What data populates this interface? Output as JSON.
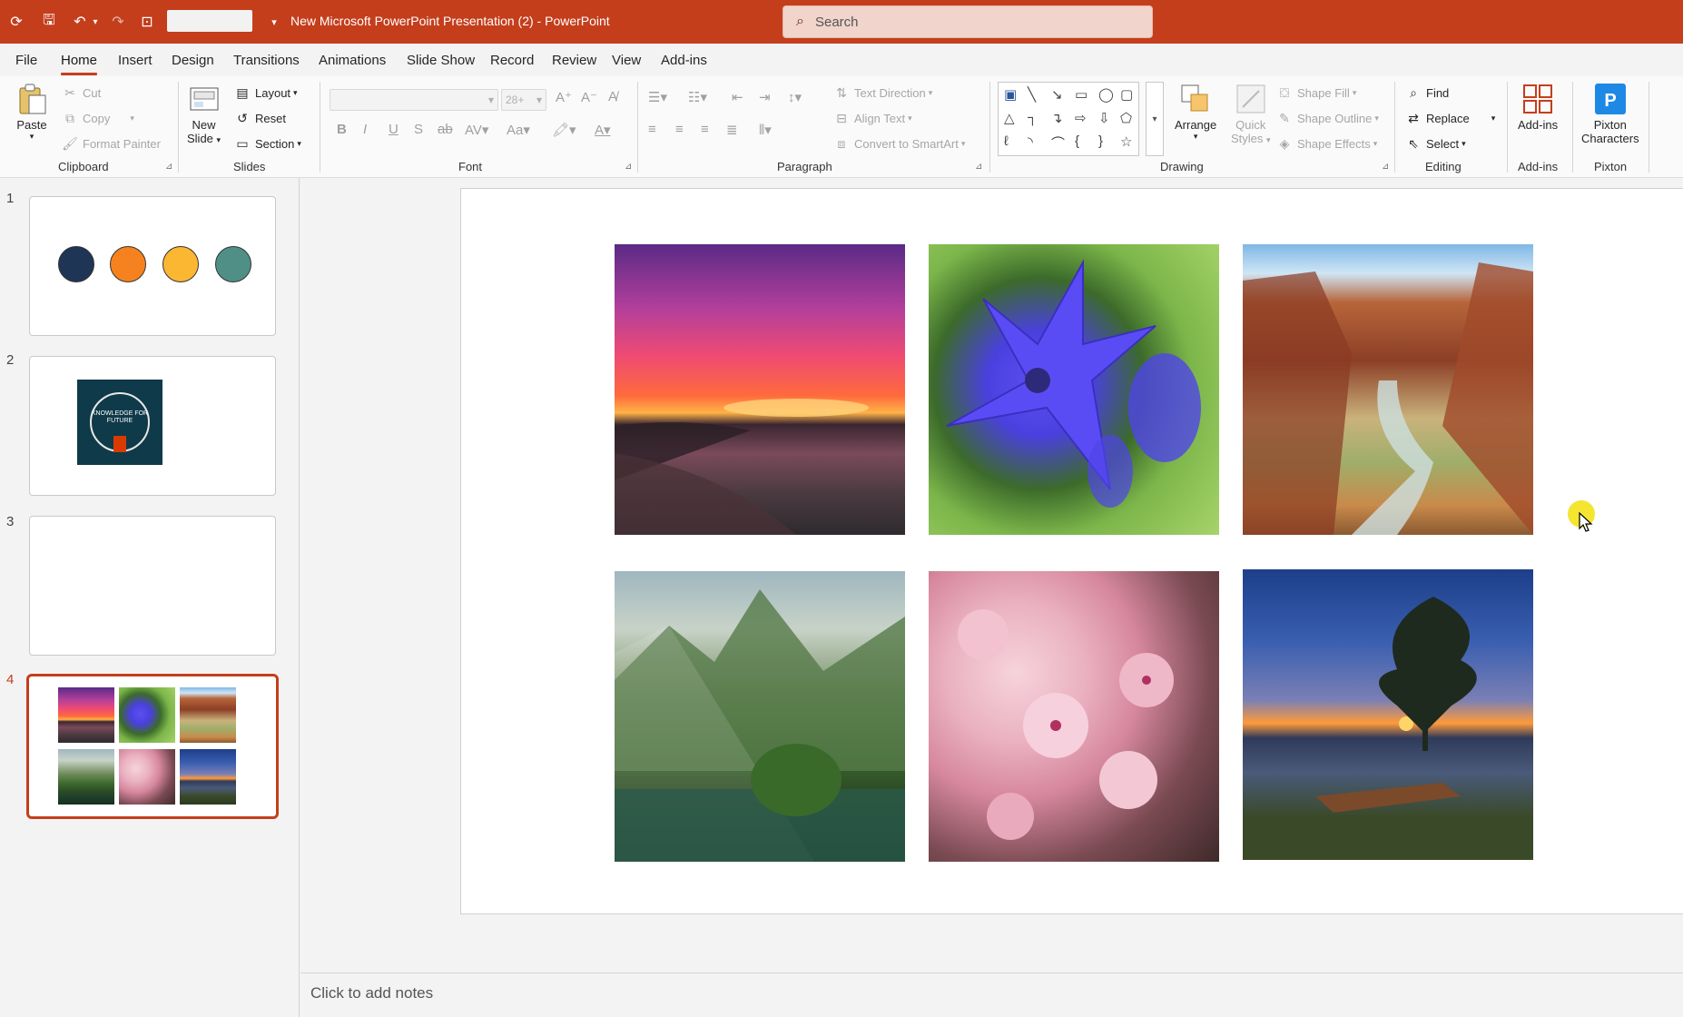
{
  "window": {
    "doc_title": "New Microsoft PowerPoint Presentation (2)  -  PowerPoint",
    "search_placeholder": "Search"
  },
  "menu": {
    "tabs": [
      "File",
      "Home",
      "Insert",
      "Design",
      "Transitions",
      "Animations",
      "Slide Show",
      "Record",
      "Review",
      "View",
      "Add-ins"
    ],
    "active": "Home"
  },
  "ribbon": {
    "clipboard": {
      "label": "Clipboard",
      "paste": "Paste",
      "cut": "Cut",
      "copy": "Copy",
      "format_painter": "Format Painter"
    },
    "slides": {
      "label": "Slides",
      "new_slide_1": "New",
      "new_slide_2": "Slide",
      "layout": "Layout",
      "reset": "Reset",
      "section": "Section"
    },
    "font": {
      "label": "Font",
      "size": "28+"
    },
    "paragraph": {
      "label": "Paragraph",
      "text_direction": "Text Direction",
      "align_text": "Align Text",
      "convert_smartart": "Convert to SmartArt"
    },
    "drawing": {
      "label": "Drawing",
      "arrange": "Arrange",
      "quick_1": "Quick",
      "quick_2": "Styles",
      "shape_fill": "Shape Fill",
      "shape_outline": "Shape Outline",
      "shape_effects": "Shape Effects"
    },
    "editing": {
      "label": "Editing",
      "find": "Find",
      "replace": "Replace",
      "select": "Select"
    },
    "addins": {
      "label": "Add-ins",
      "button": "Add-ins"
    },
    "pixton": {
      "label": "Pixton",
      "button_1": "Pixton",
      "button_2": "Characters"
    }
  },
  "thumbnails": {
    "numbers": [
      "1",
      "2",
      "3",
      "4"
    ],
    "selected": 4,
    "slide1_colors": [
      "#1e3556",
      "#f5821f",
      "#fbb731",
      "#4f8f86"
    ],
    "slide2_logo_text": "KNOWLEDGE FOR FUTURE"
  },
  "slide": {
    "images": [
      "sunset-beach",
      "blue-flower",
      "canyon-river",
      "mountain-lake",
      "cherry-blossom",
      "lake-sunset-tree"
    ]
  },
  "notes": {
    "placeholder": "Click to add notes"
  }
}
